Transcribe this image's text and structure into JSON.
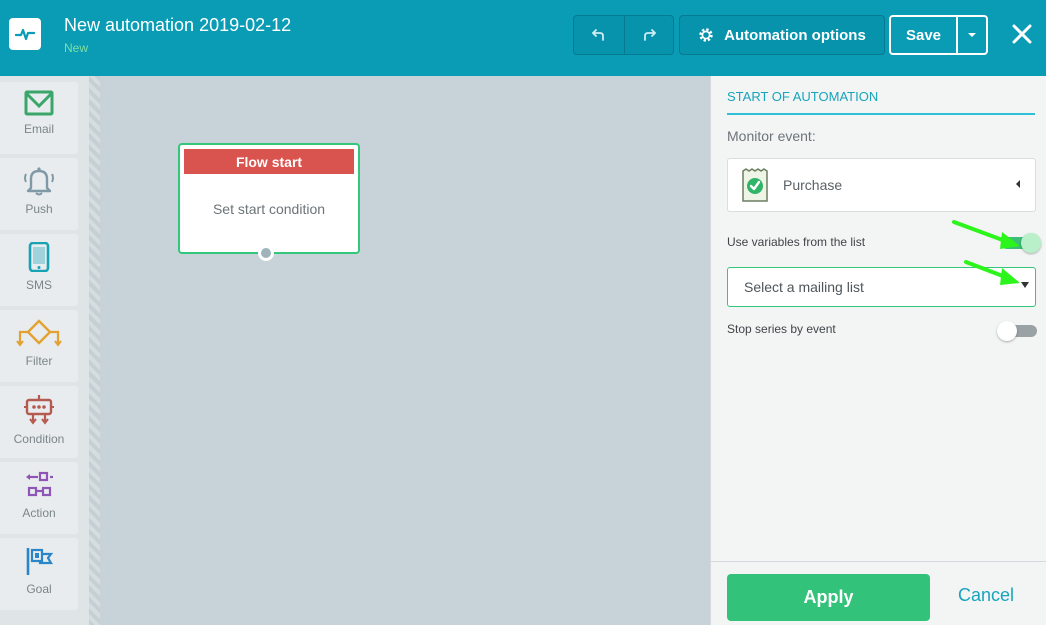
{
  "header": {
    "title": "New automation 2019-02-12",
    "status": "New",
    "options_label": "Automation options",
    "save_label": "Save"
  },
  "toolbar": {
    "items": [
      {
        "label": "Email",
        "icon": "envelope-icon",
        "color": "#3aa66a"
      },
      {
        "label": "Push",
        "icon": "bell-icon",
        "color": "#7f9aa6"
      },
      {
        "label": "SMS",
        "icon": "phone-icon",
        "color": "#17a3b4"
      },
      {
        "label": "Filter",
        "icon": "filter-diamond-icon",
        "color": "#e3a132"
      },
      {
        "label": "Condition",
        "icon": "robot-icon",
        "color": "#b55a4f"
      },
      {
        "label": "Action",
        "icon": "action-arrows-icon",
        "color": "#8e55b6"
      },
      {
        "label": "Goal",
        "icon": "flag-icon",
        "color": "#2a86c8"
      }
    ]
  },
  "canvas": {
    "node": {
      "title": "Flow start",
      "body": "Set start condition"
    }
  },
  "panel": {
    "heading": "START OF AUTOMATION",
    "monitor_label": "Monitor event:",
    "event_value": "Purchase",
    "use_variables_label": "Use variables from the list",
    "use_variables_on": true,
    "mailing_list_placeholder": "Select a mailing list",
    "stop_series_label": "Stop series by event",
    "stop_series_on": false,
    "apply_label": "Apply",
    "cancel_label": "Cancel"
  },
  "colors": {
    "header_bg": "#0a9bb5",
    "accent_green": "#33c27a",
    "flow_start_red": "#d9534f",
    "link_teal": "#18a4bb"
  }
}
